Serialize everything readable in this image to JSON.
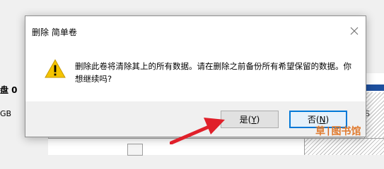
{
  "background": {
    "disk_label": "盘 0",
    "disk_size": "GB",
    "right_label": "S"
  },
  "dialog": {
    "title": "删除 简单卷",
    "message": "删除此卷将清除其上的所有数据。请在删除之前备份所有希望保留的数据。你想继续吗?",
    "icons": {
      "close": "close-icon",
      "warning": "warning-icon"
    },
    "buttons": {
      "yes_prefix": "是(",
      "yes_key": "Y",
      "yes_suffix": ")",
      "no_prefix": "否(",
      "no_key": "N",
      "no_suffix": ")"
    }
  },
  "annotation": {
    "arrow_color": "#e0202a"
  },
  "watermark": {
    "part1": "草",
    "part2": "图书馆"
  },
  "colors": {
    "accent": "#0078d7",
    "warning": "#f5c400"
  }
}
